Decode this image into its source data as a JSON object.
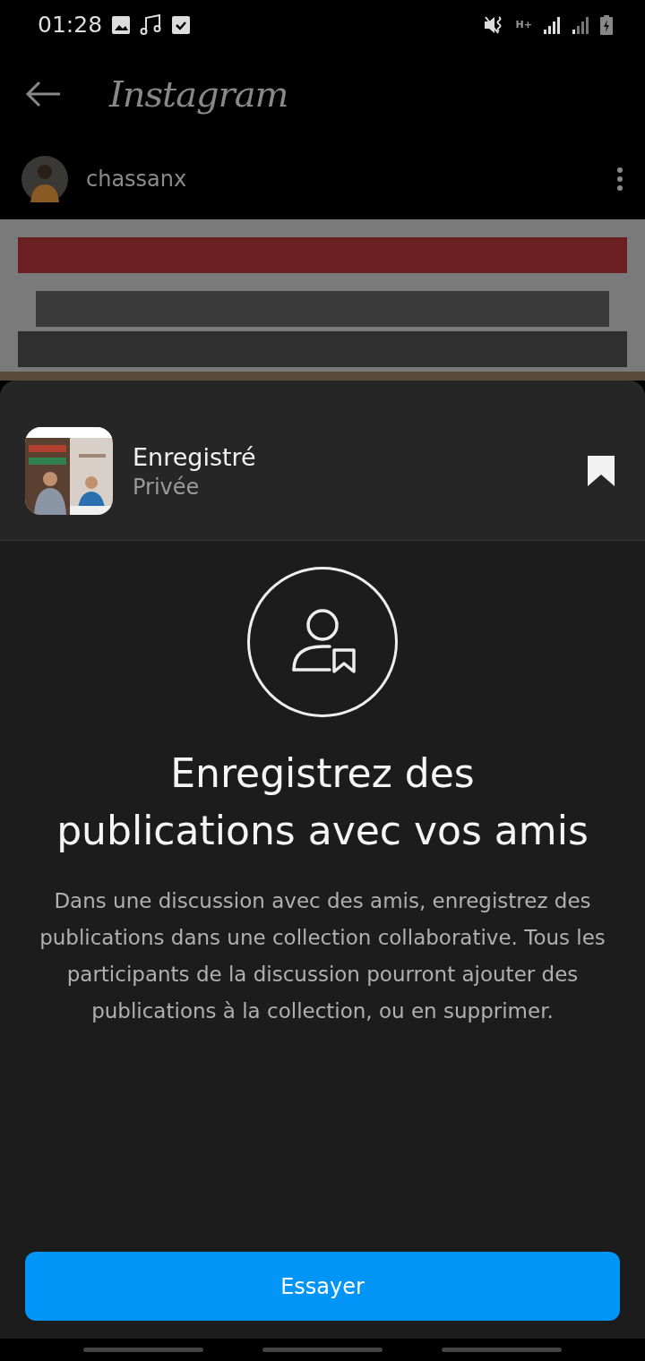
{
  "status_bar": {
    "time": "01:28",
    "network": "H+"
  },
  "header": {
    "title": "Instagram"
  },
  "post": {
    "username": "chassanx"
  },
  "sheet": {
    "collection": {
      "name": "Enregistré",
      "privacy": "Privée",
      "saved": true
    },
    "title": "Enregistrez des publications avec vos amis",
    "body": "Dans une discussion avec des amis, enregistrez des publications dans une collection collaborative. Tous les participants de la discussion pourront ajouter des publications à la collection, ou en supprimer.",
    "button": "Essayer"
  }
}
